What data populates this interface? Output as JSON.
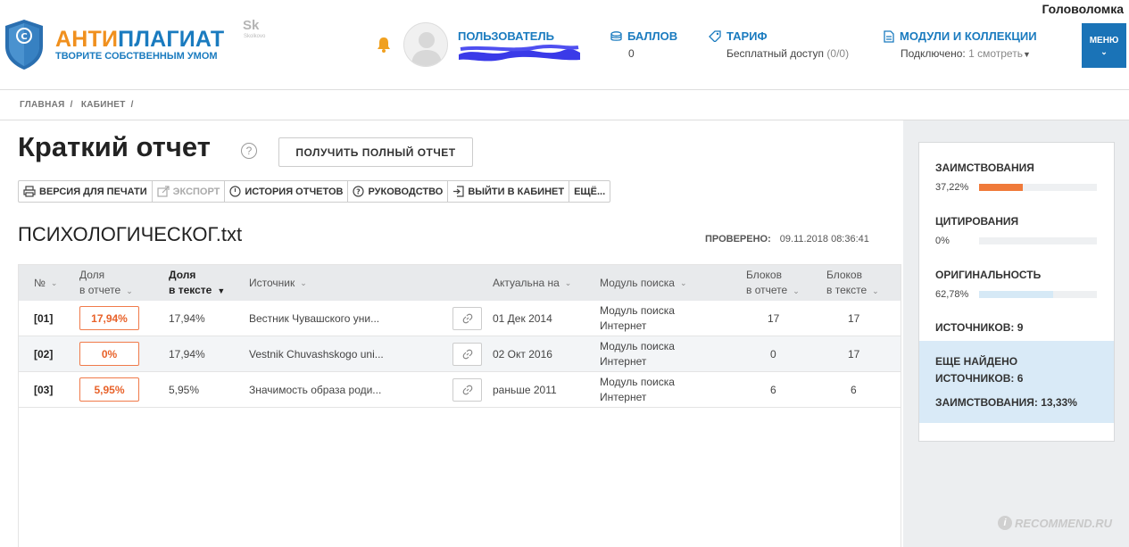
{
  "corner_text": "Головоломка",
  "logo": {
    "part1": "АНТИ",
    "part2": "ПЛАГИАТ",
    "tagline": "ТВОРИТЕ СОБСТВЕННЫМ УМОМ",
    "shield_letter": "©"
  },
  "skolkovo": {
    "mark": "Sk",
    "caption": "Skolkovo"
  },
  "header": {
    "user_label": "ПОЛЬЗОВАТЕЛЬ",
    "points": {
      "title": "БАЛЛОВ",
      "value": "0"
    },
    "tariff": {
      "title": "ТАРИФ",
      "value": "Бесплатный доступ",
      "count": "(0/0)"
    },
    "modules": {
      "title": "МОДУЛИ И КОЛЛЕКЦИИ",
      "connected": "Подключено: ",
      "connected_count": "1",
      "view": "смотреть"
    },
    "menu_label": "МЕНЮ"
  },
  "breadcrumb": [
    "ГЛАВНАЯ",
    "/",
    "КАБИНЕТ",
    "/"
  ],
  "page": {
    "title": "Краткий отчет",
    "help": "?",
    "full_report_button": "ПОЛУЧИТЬ ПОЛНЫЙ ОТЧЕТ",
    "toolbar": {
      "print": "ВЕРСИЯ ДЛЯ ПЕЧАТИ",
      "export": "ЭКСПОРТ",
      "history": "ИСТОРИЯ ОТЧЕТОВ",
      "guide": "РУКОВОДСТВО",
      "exit": "ВЫЙТИ В КАБИНЕТ",
      "more": "ЕЩЁ..."
    },
    "document_name": "ПСИХОЛОГИЧЕСКОГ.txt",
    "checked_label": "ПРОВЕРЕНО:",
    "checked_value": "09.11.2018 08:36:41"
  },
  "table": {
    "headers": {
      "num": "№",
      "share_report_1": "Доля",
      "share_report_2": "в отчете",
      "share_text_1": "Доля",
      "share_text_2": "в тексте",
      "source": "Источник",
      "actual": "Актуальна на",
      "module": "Модуль поиска",
      "blocks_report_1": "Блоков",
      "blocks_report_2": "в отчете",
      "blocks_text_1": "Блоков",
      "blocks_text_2": "в тексте"
    },
    "rows": [
      {
        "num": "[01]",
        "share_report": "17,94%",
        "share_text": "17,94%",
        "source": "Вестник Чувашского уни...",
        "actual": "01 Дек 2014",
        "module_1": "Модуль поиска",
        "module_2": "Интернет",
        "blocks_report": "17",
        "blocks_text": "17"
      },
      {
        "num": "[02]",
        "share_report": "0%",
        "share_text": "17,94%",
        "source": "Vestnik Chuvashskogo uni...",
        "actual": "02 Окт 2016",
        "module_1": "Модуль поиска",
        "module_2": "Интернет",
        "blocks_report": "0",
        "blocks_text": "17"
      },
      {
        "num": "[03]",
        "share_report": "5,95%",
        "share_text": "5,95%",
        "source": "Значимость образа роди...",
        "actual": "раньше 2011",
        "module_1": "Модуль поиска",
        "module_2": "Интернет",
        "blocks_report": "6",
        "blocks_text": "6"
      }
    ]
  },
  "summary": {
    "borrowings": {
      "label": "ЗАИМСТВОВАНИЯ",
      "value": "37,22%",
      "fraction": 0.3722,
      "color": "#f07a3a"
    },
    "citations": {
      "label": "ЦИТИРОВАНИЯ",
      "value": "0%",
      "fraction": 0,
      "color": "#f07a3a"
    },
    "originality": {
      "label": "ОРИГИНАЛЬНОСТЬ",
      "value": "62,78%",
      "fraction": 0.6278,
      "color": "#d6e9f6"
    },
    "sources_label": "ИСТОЧНИКОВ:",
    "sources_count": "9",
    "found_line1": "ЕЩЕ НАЙДЕНО",
    "found_line2_label": "ИСТОЧНИКОВ:",
    "found_line2_value": "6",
    "found_borrow_label": "ЗАИМСТВОВАНИЯ:",
    "found_borrow_value": "13,33%"
  },
  "watermark": "RECOMMEND.RU",
  "colors": {
    "brand_blue": "#1a7bbf",
    "brand_orange": "#f0901e",
    "alert_orange": "#e8622a"
  }
}
